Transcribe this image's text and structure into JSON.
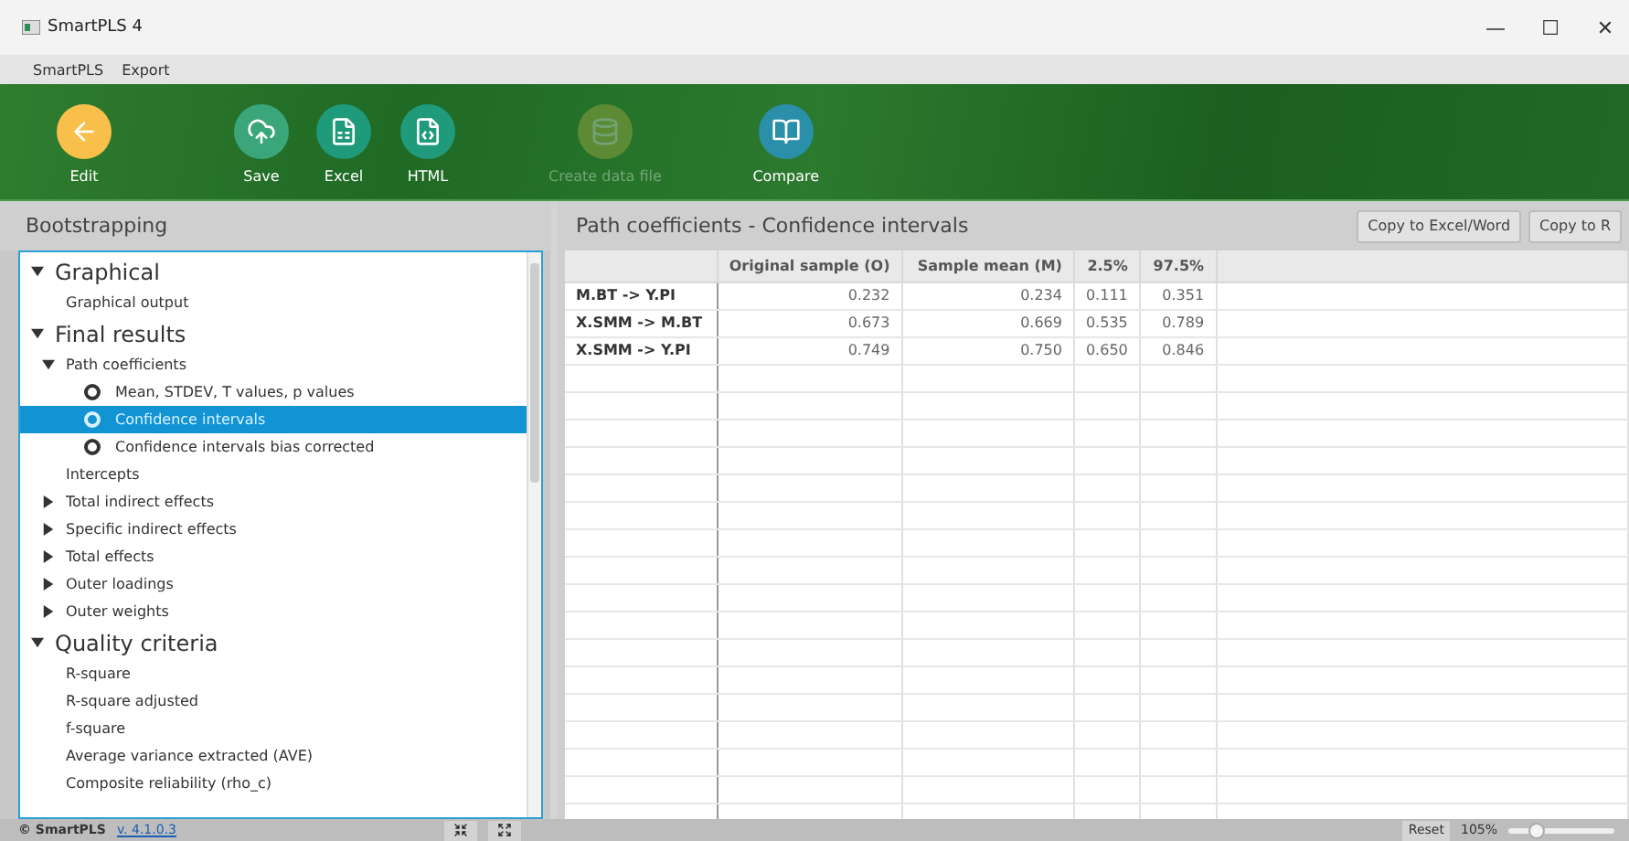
{
  "window": {
    "title": "SmartPLS 4",
    "controls": [
      "—",
      "☐",
      "✕"
    ]
  },
  "menu": [
    "SmartPLS",
    "Export"
  ],
  "toolbar": [
    {
      "label": "Edit",
      "kind": "back",
      "disabled": false
    },
    {
      "label": "Save",
      "kind": "save",
      "disabled": false
    },
    {
      "label": "Excel",
      "kind": "excel",
      "disabled": false
    },
    {
      "label": "HTML",
      "kind": "html",
      "disabled": false
    },
    {
      "label": "Create data file",
      "kind": "data",
      "disabled": true
    },
    {
      "label": "Compare",
      "kind": "compare",
      "disabled": false
    }
  ],
  "sidebar": {
    "title": "Bootstrapping",
    "items": [
      {
        "kind": "section",
        "label": "Graphical",
        "expanded": true,
        "children": [
          {
            "kind": "leaf",
            "label": "Graphical output"
          }
        ]
      },
      {
        "kind": "section",
        "label": "Final results",
        "expanded": true,
        "children": [
          {
            "kind": "group",
            "label": "Path coefficients",
            "expanded": true,
            "children": [
              {
                "kind": "radio",
                "label": "Mean, STDEV, T values, p values",
                "selected": false
              },
              {
                "kind": "radio",
                "label": "Confidence intervals",
                "selected": true
              },
              {
                "kind": "radio",
                "label": "Confidence intervals bias corrected",
                "selected": false
              }
            ]
          },
          {
            "kind": "leaf",
            "label": "Intercepts"
          },
          {
            "kind": "group",
            "label": "Total indirect effects",
            "expanded": false
          },
          {
            "kind": "group",
            "label": "Specific indirect effects",
            "expanded": false
          },
          {
            "kind": "group",
            "label": "Total effects",
            "expanded": false
          },
          {
            "kind": "group",
            "label": "Outer loadings",
            "expanded": false
          },
          {
            "kind": "group",
            "label": "Outer weights",
            "expanded": false
          }
        ]
      },
      {
        "kind": "section",
        "label": "Quality criteria",
        "expanded": true,
        "children": [
          {
            "kind": "leaf",
            "label": "R-square"
          },
          {
            "kind": "leaf",
            "label": "R-square adjusted"
          },
          {
            "kind": "leaf",
            "label": "f-square"
          },
          {
            "kind": "leaf",
            "label": "Average variance extracted (AVE)"
          },
          {
            "kind": "leaf",
            "label": "Composite reliability (rho_c)"
          }
        ]
      }
    ]
  },
  "content": {
    "title": "Path coefficients - Confidence intervals",
    "buttons": [
      "Copy to Excel/Word",
      "Copy to R"
    ],
    "table": {
      "columns": [
        "Original sample (O)",
        "Sample mean (M)",
        "2.5%",
        "97.5%"
      ],
      "rows": [
        {
          "name": "M.BT -> Y.PI",
          "cells": [
            "0.232",
            "0.234",
            "0.111",
            "0.351"
          ]
        },
        {
          "name": "X.SMM -> M.BT",
          "cells": [
            "0.673",
            "0.669",
            "0.535",
            "0.789"
          ]
        },
        {
          "name": "X.SMM -> Y.PI",
          "cells": [
            "0.749",
            "0.750",
            "0.650",
            "0.846"
          ]
        }
      ]
    }
  },
  "status_bar": {
    "copyright": "© SmartPLS",
    "version": "v. 4.1.0.3",
    "reset": "Reset",
    "zoom": "105%",
    "zoom_slider": {
      "level": 0.25
    }
  }
}
